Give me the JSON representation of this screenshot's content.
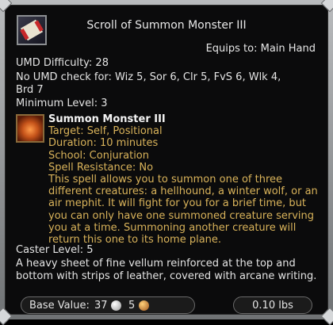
{
  "item": {
    "title": "Scroll of Summon Monster III",
    "equips_to": "Equips to: Main Hand",
    "umd_difficulty": "UMD Difficulty: 28",
    "no_umd_line1": "No UMD check for: Wiz 5, Sor 6, Clr 5, FvS 6, Wlk 4,",
    "no_umd_line2": "Brd 7",
    "minimum_level": "Minimum Level: 3",
    "caster_level": "Caster Level: 5",
    "description": "A heavy sheet of fine vellum reinforced at the top and bottom with strips of leather, covered with arcane writing."
  },
  "spell": {
    "name": "Summon Monster III",
    "target": "Target: Self, Positional",
    "duration": "Duration: 10 minutes",
    "school": "School: Conjuration",
    "resistance": "Spell Resistance: No",
    "description": "This spell allows you to summon one of three different creatures: a hellhound, a winter wolf, or an air mephit. It will fight for you for a brief time, but you can only have one summoned creature serving you at a time. Summoning another creature will return this one to its home plane."
  },
  "footer": {
    "base_value_label": "Base Value:",
    "silver": "37",
    "copper": "5",
    "weight": "0.10 lbs"
  },
  "icons": {
    "item": "scroll-icon",
    "spell": "summon-spell-icon",
    "silver": "silver-coin-icon",
    "copper": "copper-coin-icon"
  },
  "colors": {
    "spell_text": "#d9b35a",
    "text": "#e4e4e4",
    "panel": "#0b0b0c"
  }
}
